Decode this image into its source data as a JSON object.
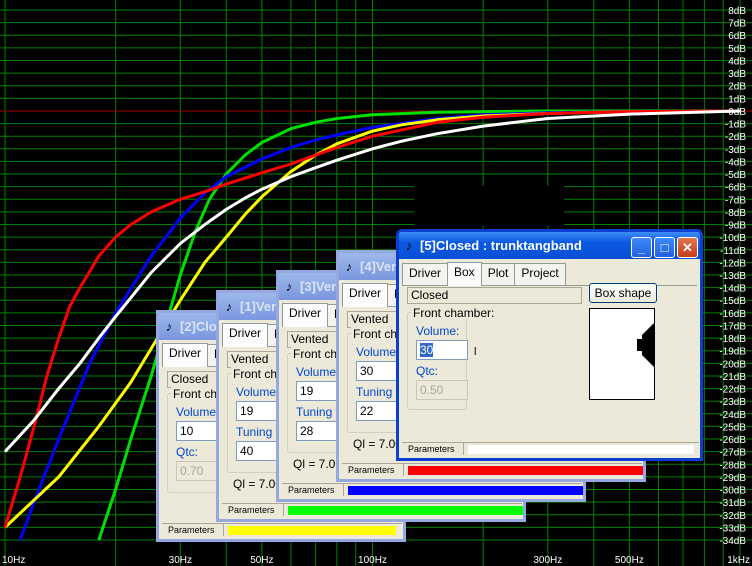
{
  "chart_data": {
    "type": "line",
    "title": "",
    "xlabel": "",
    "ylabel": "",
    "x_scale": "log",
    "xlim": [
      10,
      1000
    ],
    "ylim": [
      -34,
      8
    ],
    "grid": true,
    "background": "#000000",
    "grid_color": "#008000",
    "zero_line_color": "#a00000",
    "x_ticks": [
      "10Hz",
      "30Hz",
      "50Hz",
      "100Hz",
      "300Hz",
      "500Hz",
      "1kHz"
    ],
    "y_ticks": [
      "8dB",
      "7dB",
      "6dB",
      "5dB",
      "4dB",
      "3dB",
      "2dB",
      "1dB",
      "0dB",
      "-1dB",
      "-2dB",
      "-3dB",
      "-4dB",
      "-5dB",
      "-6dB",
      "-7dB",
      "-8dB",
      "-9dB",
      "-10dB",
      "-11dB",
      "-12dB",
      "-13dB",
      "-14dB",
      "-15dB",
      "-16dB",
      "-17dB",
      "-18dB",
      "-19dB",
      "-20dB",
      "-21dB",
      "-22dB",
      "-23dB",
      "-24dB",
      "-25dB",
      "-26dB",
      "-27dB",
      "-28dB",
      "-29dB",
      "-30dB",
      "-31dB",
      "-32dB",
      "-33dB",
      "-34dB"
    ],
    "series": [
      {
        "color": "#00e000",
        "x": [
          18,
          20,
          22,
          25,
          28,
          30,
          33,
          36,
          40,
          45,
          50,
          60,
          70,
          80,
          100,
          150,
          200,
          300,
          500,
          1000
        ],
        "y": [
          -34,
          -30,
          -26,
          -21,
          -16,
          -13,
          -9.5,
          -7,
          -5,
          -3.5,
          -2.5,
          -1.4,
          -0.9,
          -0.6,
          -0.3,
          -0.1,
          -0.05,
          0,
          0,
          0
        ]
      },
      {
        "color": "#0000ff",
        "x": [
          11,
          12,
          14,
          17,
          20,
          25,
          30,
          35,
          40,
          50,
          60,
          70,
          80,
          100,
          150,
          200,
          300,
          500,
          1000
        ],
        "y": [
          -34,
          -31,
          -26,
          -20,
          -16,
          -11.5,
          -8.5,
          -6.5,
          -5.2,
          -3.8,
          -2.9,
          -2.3,
          -1.9,
          -1.3,
          -0.6,
          -0.3,
          -0.15,
          -0.05,
          0
        ]
      },
      {
        "color": "#ffff00",
        "x": [
          10,
          14,
          18,
          22,
          26,
          30,
          35,
          40,
          45,
          50,
          60,
          70,
          80,
          100,
          120,
          150,
          200,
          300,
          500,
          1000
        ],
        "y": [
          -33,
          -29,
          -25,
          -21.5,
          -18,
          -15,
          -12,
          -10,
          -8.2,
          -6.8,
          -4.8,
          -3.5,
          -2.6,
          -1.6,
          -1.1,
          -0.7,
          -0.4,
          -0.2,
          -0.05,
          0
        ]
      },
      {
        "color": "#ff0000",
        "x": [
          10,
          11,
          12,
          13,
          14,
          15,
          16,
          18,
          20,
          22,
          25,
          30,
          35,
          40,
          50,
          60,
          70,
          80,
          100,
          150,
          200,
          300,
          500,
          1000
        ],
        "y": [
          -33,
          -29,
          -25,
          -21,
          -18,
          -15.5,
          -14,
          -11.5,
          -10,
          -9,
          -8,
          -7,
          -6.4,
          -5.8,
          -4.9,
          -4.2,
          -3.5,
          -2.9,
          -2,
          -0.9,
          -0.5,
          -0.2,
          -0.05,
          0
        ]
      },
      {
        "color": "#ffffff",
        "x": [
          10,
          12,
          14,
          16,
          18,
          20,
          25,
          30,
          35,
          40,
          45,
          50,
          60,
          70,
          80,
          100,
          120,
          150,
          200,
          300,
          500,
          1000
        ],
        "y": [
          -27,
          -24.5,
          -22,
          -20,
          -18,
          -16.3,
          -12.8,
          -10.5,
          -9,
          -7.8,
          -6.9,
          -6.2,
          -5.2,
          -4.5,
          -3.9,
          -3,
          -2.4,
          -1.8,
          -1.2,
          -0.6,
          -0.25,
          0
        ]
      }
    ]
  },
  "windows": [
    {
      "id": "w2",
      "title": "[2]Closed : trunktangband",
      "tabs": [
        "Driver",
        "Box"
      ],
      "boxtype": "Closed",
      "group_label": "Front chamber:",
      "volume_label": "Volume:",
      "volume_value": "10",
      "field2_label": "Qtc:",
      "field2_value": "0.70",
      "ql_text": "",
      "param_label": "Parameters",
      "bar_color": "#ffff00"
    },
    {
      "id": "w1",
      "title": "[1]Vented : trunktangband",
      "tabs": [
        "Driver",
        "Box"
      ],
      "boxtype": "Vented",
      "group_label": "Front chamber:",
      "volume_label": "Volume:",
      "volume_value": "19",
      "field2_label": "Tuning freq.:",
      "field2_value": "40",
      "ql_text": "Ql = 7.00",
      "param_label": "Parameters",
      "bar_color": "#00ff00"
    },
    {
      "id": "w3",
      "title": "[3]Vented : trunktangband",
      "tabs": [
        "Driver",
        "Box"
      ],
      "boxtype": "Vented",
      "group_label": "Front chamber:",
      "volume_label": "Volume:",
      "volume_value": "19",
      "field2_label": "Tuning freq.:",
      "field2_value": "28",
      "ql_text": "Ql = 7.00",
      "param_label": "Parameters",
      "bar_color": "#0000ff"
    },
    {
      "id": "w4",
      "title": "[4]Vented : trunktangband",
      "tabs": [
        "Driver",
        "Box"
      ],
      "boxtype": "Vented",
      "group_label": "Front chamber:",
      "volume_label": "Volume:",
      "volume_value": "30",
      "field2_label": "Tuning freq.:",
      "field2_value": "22",
      "ql_text": "Ql = 7.00",
      "param_label": "Parameters",
      "bar_color": "#ff0000"
    },
    {
      "id": "w5",
      "title": "[5]Closed : trunktangband",
      "tabs": [
        "Driver",
        "Box",
        "Plot",
        "Project"
      ],
      "boxtype": "Closed",
      "group_label": "Front chamber:",
      "volume_label": "Volume:",
      "volume_value": "30",
      "field2_label": "Qtc:",
      "field2_value": "0.50",
      "ql_text": "",
      "param_label": "Parameters",
      "bar_color": "#ffffff",
      "shape_button": "Box shape",
      "unit_suffix": "l"
    }
  ]
}
